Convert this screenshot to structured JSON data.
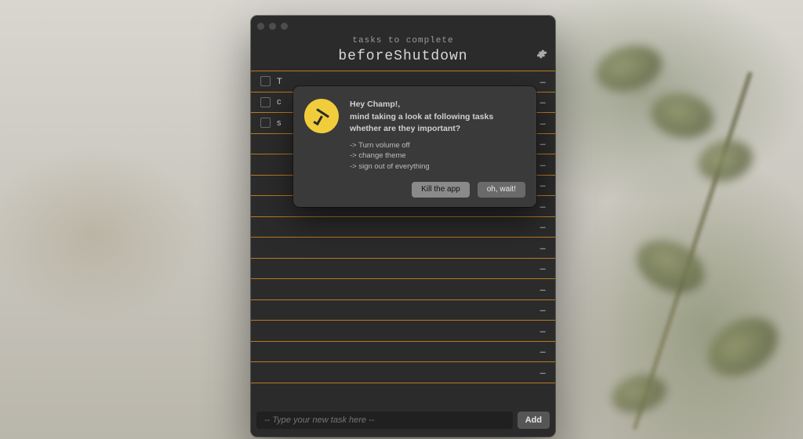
{
  "header": {
    "subtitle": "tasks to complete",
    "title": "beforeShutdown"
  },
  "rows": [
    {
      "text": "T",
      "has_checkbox": true
    },
    {
      "text": "c",
      "has_checkbox": true
    },
    {
      "text": "s",
      "has_checkbox": true
    },
    {
      "text": "",
      "has_checkbox": false
    },
    {
      "text": "",
      "has_checkbox": false
    },
    {
      "text": "",
      "has_checkbox": false
    },
    {
      "text": "",
      "has_checkbox": false
    },
    {
      "text": "",
      "has_checkbox": false
    },
    {
      "text": "",
      "has_checkbox": false
    },
    {
      "text": "",
      "has_checkbox": false
    },
    {
      "text": "",
      "has_checkbox": false
    },
    {
      "text": "",
      "has_checkbox": false
    },
    {
      "text": "",
      "has_checkbox": false
    },
    {
      "text": "",
      "has_checkbox": false
    },
    {
      "text": "",
      "has_checkbox": false
    }
  ],
  "footer": {
    "placeholder": "-- Type your new task here --",
    "add_label": "Add"
  },
  "dialog": {
    "greeting": "Hey Champ!,",
    "message_l1": "mind taking a look at following tasks",
    "message_l2": "whether are they important?",
    "tasks": [
      "-> Turn volume off",
      "-> change theme",
      "-> sign out of everything"
    ],
    "btn_primary": "Kill the app",
    "btn_secondary": "oh, wait!"
  },
  "colors": {
    "accent_line": "#b87a1f",
    "dialog_icon": "#f1cd3b"
  }
}
